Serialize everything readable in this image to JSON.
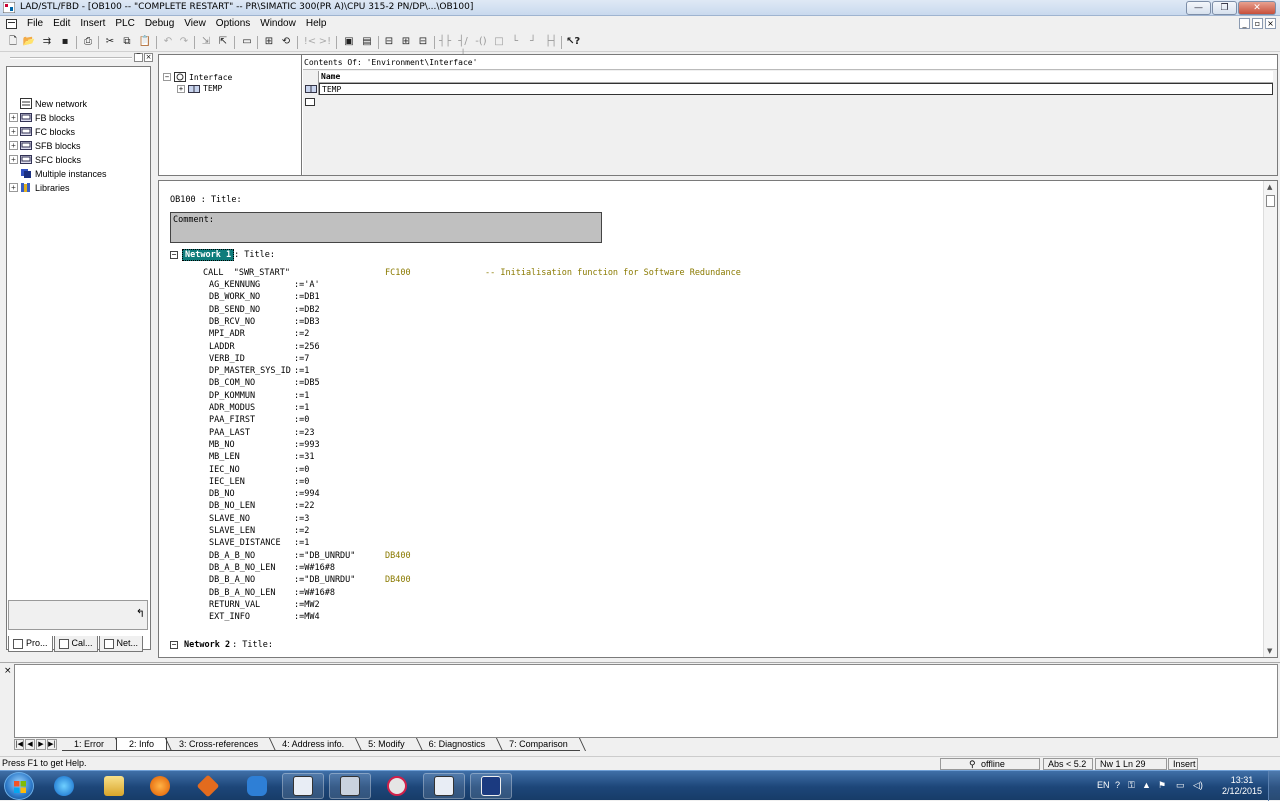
{
  "window": {
    "title": "LAD/STL/FBD  - [OB100 -- \"COMPLETE RESTART\" -- PR\\SIMATIC 300(PR A)\\CPU 315-2 PN/DP\\...\\OB100]"
  },
  "menu": [
    "File",
    "Edit",
    "Insert",
    "PLC",
    "Debug",
    "View",
    "Options",
    "Window",
    "Help"
  ],
  "program_elements": {
    "items": [
      {
        "label": "New network",
        "expandable": false,
        "icon": "network-icon"
      },
      {
        "label": "FB blocks",
        "expandable": true,
        "icon": "block-folder-icon"
      },
      {
        "label": "FC blocks",
        "expandable": true,
        "icon": "block-folder-icon"
      },
      {
        "label": "SFB blocks",
        "expandable": true,
        "icon": "block-folder-icon"
      },
      {
        "label": "SFC blocks",
        "expandable": true,
        "icon": "block-folder-icon"
      },
      {
        "label": "Multiple instances",
        "expandable": false,
        "icon": "multi-instance-icon"
      },
      {
        "label": "Libraries",
        "expandable": true,
        "icon": "library-icon"
      }
    ],
    "tabs": [
      "Pro...",
      "Cal...",
      "Net..."
    ]
  },
  "interface": {
    "tree": {
      "root": "Interface",
      "child": "TEMP"
    },
    "contents_header": "Contents Of: 'Environment\\Interface'",
    "column_name": "Name",
    "rows": [
      "TEMP"
    ]
  },
  "editor": {
    "block_title": "OB100 : Title:",
    "comment_label": "Comment:",
    "network1": {
      "label": "Network 1",
      "suffix": ": Title:"
    },
    "call_line": {
      "call": "CALL  \"SWR_START\"",
      "fc": "FC100",
      "comment": "-- Initialisation function for Software Redundance"
    },
    "params": [
      {
        "name": "AG_KENNUNG",
        "value": ":='A'",
        "db": ""
      },
      {
        "name": "DB_WORK_NO",
        "value": ":=DB1",
        "db": ""
      },
      {
        "name": "DB_SEND_NO",
        "value": ":=DB2",
        "db": ""
      },
      {
        "name": "DB_RCV_NO",
        "value": ":=DB3",
        "db": ""
      },
      {
        "name": "MPI_ADR",
        "value": ":=2",
        "db": ""
      },
      {
        "name": "LADDR",
        "value": ":=256",
        "db": ""
      },
      {
        "name": "VERB_ID",
        "value": ":=7",
        "db": ""
      },
      {
        "name": "DP_MASTER_SYS_ID",
        "value": ":=1",
        "db": ""
      },
      {
        "name": "DB_COM_NO",
        "value": ":=DB5",
        "db": ""
      },
      {
        "name": "DP_KOMMUN",
        "value": ":=1",
        "db": ""
      },
      {
        "name": "ADR_MODUS",
        "value": ":=1",
        "db": ""
      },
      {
        "name": "PAA_FIRST",
        "value": ":=0",
        "db": ""
      },
      {
        "name": "PAA_LAST",
        "value": ":=23",
        "db": ""
      },
      {
        "name": "MB_NO",
        "value": ":=993",
        "db": ""
      },
      {
        "name": "MB_LEN",
        "value": ":=31",
        "db": ""
      },
      {
        "name": "IEC_NO",
        "value": ":=0",
        "db": ""
      },
      {
        "name": "IEC_LEN",
        "value": ":=0",
        "db": ""
      },
      {
        "name": "DB_NO",
        "value": ":=994",
        "db": ""
      },
      {
        "name": "DB_NO_LEN",
        "value": ":=22",
        "db": ""
      },
      {
        "name": "SLAVE_NO",
        "value": ":=3",
        "db": ""
      },
      {
        "name": "SLAVE_LEN",
        "value": ":=2",
        "db": ""
      },
      {
        "name": "SLAVE_DISTANCE",
        "value": ":=1",
        "db": ""
      },
      {
        "name": "DB_A_B_NO",
        "value": ":=\"DB_UNRDU\"",
        "db": "DB400"
      },
      {
        "name": "DB_A_B_NO_LEN",
        "value": ":=W#16#8",
        "db": ""
      },
      {
        "name": "DB_B_A_NO",
        "value": ":=\"DB_UNRDU\"",
        "db": "DB400"
      },
      {
        "name": "DB_B_A_NO_LEN",
        "value": ":=W#16#8",
        "db": ""
      },
      {
        "name": "RETURN_VAL",
        "value": ":=MW2",
        "db": ""
      },
      {
        "name": "EXT_INFO",
        "value": ":=MW4",
        "db": ""
      }
    ],
    "network2": {
      "label": "Network 2",
      "suffix": ": Title:"
    }
  },
  "output": {
    "tabs": [
      "1: Error",
      "2: Info",
      "3: Cross-references",
      "4: Address info.",
      "5: Modify",
      "6: Diagnostics",
      "7: Comparison"
    ],
    "active_tab": "2: Info"
  },
  "status": {
    "help": "Press F1 to get Help.",
    "mode": "offline",
    "abs": "Abs < 5.2",
    "position": "Nw 1 Ln 29",
    "insert": "Insert"
  },
  "taskbar": {
    "lang": "EN",
    "time": "13:31",
    "date": "2/12/2015"
  },
  "colors": {
    "accent_teal": "#0e7c7b",
    "db_olive": "#8a7a00",
    "taskbar": "#1d4679"
  }
}
